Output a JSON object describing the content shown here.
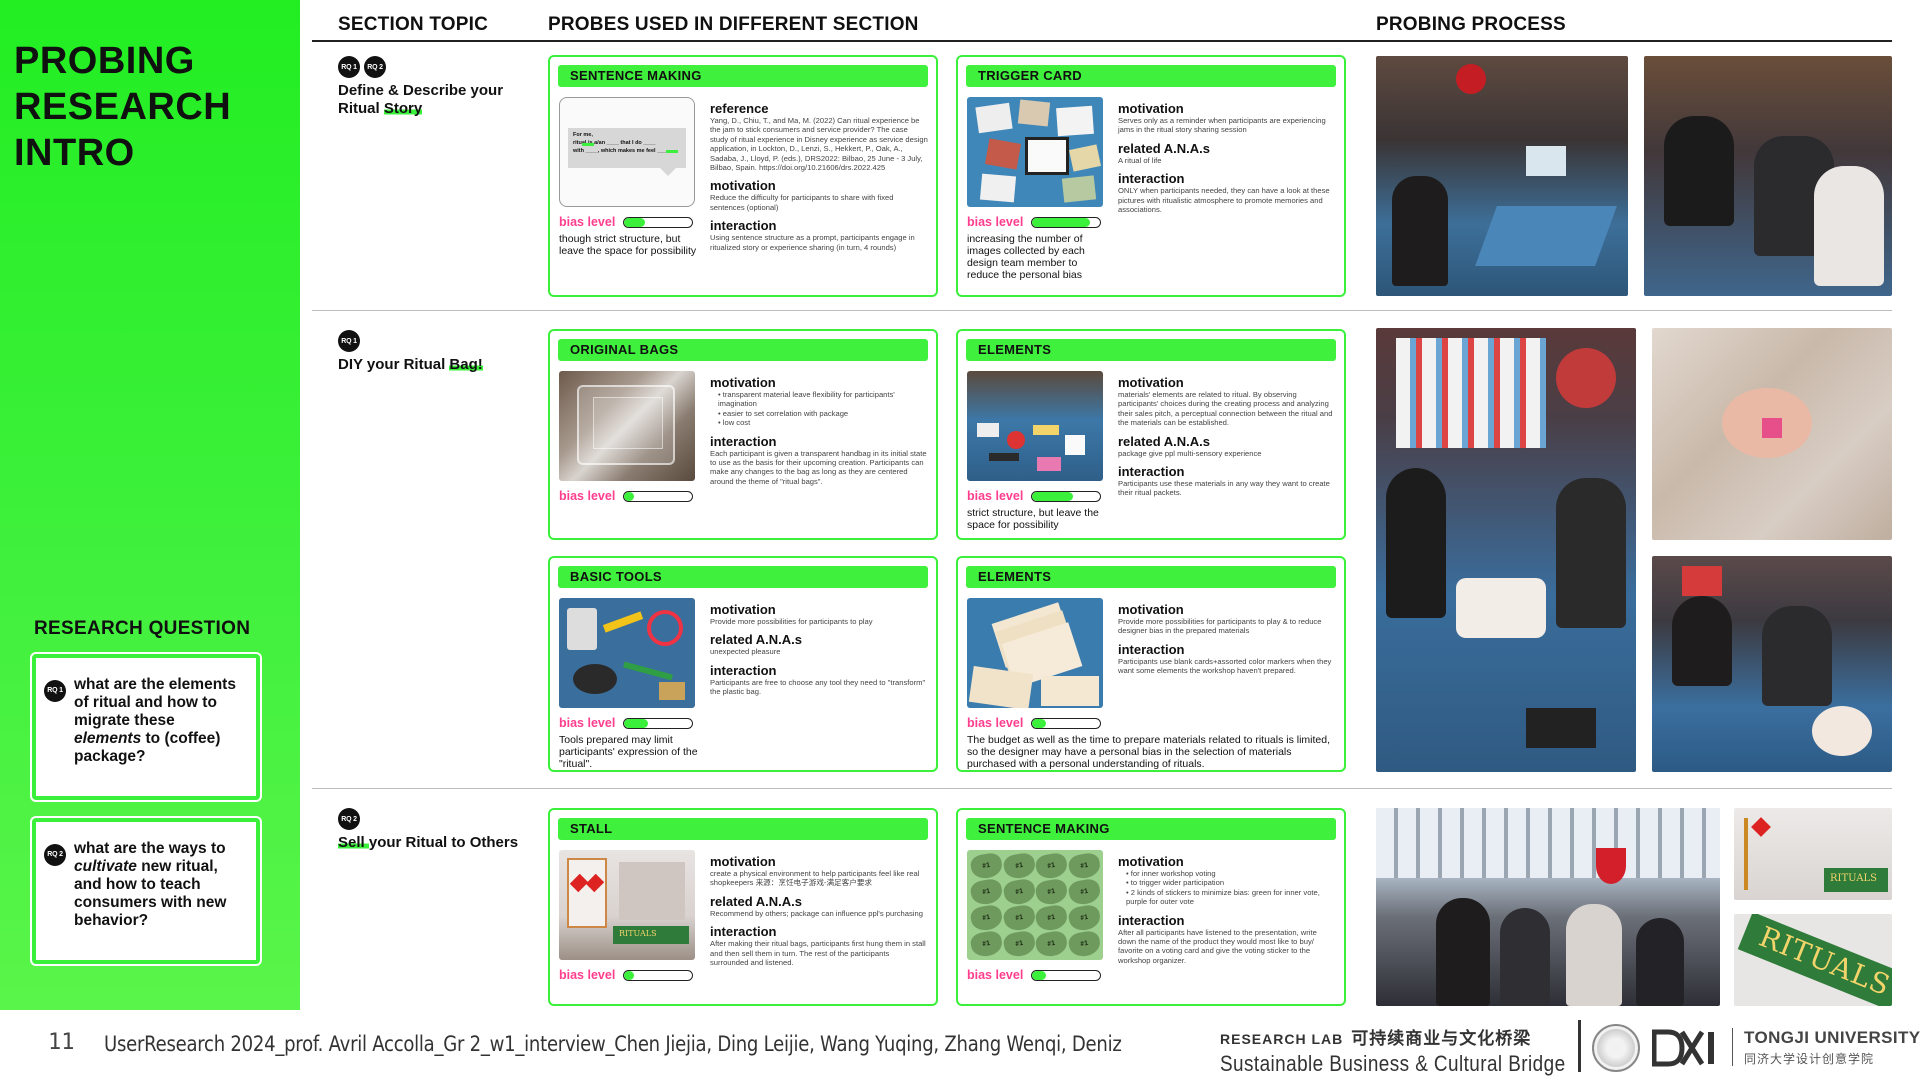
{
  "title": {
    "line1": "PROBING",
    "line2": "RESEARCH",
    "line3": "INTRO"
  },
  "research_question": {
    "heading": "RESEARCH QUESTION",
    "rq1": {
      "badge": "RQ 1",
      "pre": "what are the elements of ritual and how to migrate these ",
      "em": "elements",
      "post": " to (coffee) package?"
    },
    "rq2": {
      "badge": "RQ 2",
      "pre": "what are the ways to ",
      "em": "cultivate",
      "post": " new ritual, and how to teach consumers with new behavior?"
    }
  },
  "headers": {
    "section_topic": "SECTION TOPIC",
    "probes": "PROBES USED IN DIFFERENT SECTION",
    "process": "PROBING PROCESS"
  },
  "topics": [
    {
      "badges": [
        "RQ 1",
        "RQ 2"
      ],
      "pre": "Define & Describe your Ritual ",
      "hl": "Story",
      "post": ""
    },
    {
      "badges": [
        "RQ 1"
      ],
      "pre": "DIY your Ritual  ",
      "hl": "Bag!",
      "post": ""
    },
    {
      "badges": [
        "RQ 2"
      ],
      "pre": "",
      "hl": "Sell ",
      "post": "your Ritual to Others"
    }
  ],
  "bias_label": "bias level",
  "cards": {
    "sentence_making_1": {
      "title": "SENTENCE MAKING",
      "bias": 0.3,
      "note": "though strict structure, but leave the space for possibility",
      "sections": [
        {
          "h": "reference",
          "p": "Yang, D., Chiu, T., and Ma, M. (2022) Can ritual experience be the jam to stick consumers and service provider? The case study of ritual experience in Disney experience as service design application, in Lockton, D., Lenzi, S., Hekkert, P., Oak, A., Sadaba, J., Lloyd, P. (eds.), DRS2022: Bilbao, 25 June - 3 July, Bilbao, Spain. https://doi.org/10.21606/drs.2022.425"
        },
        {
          "h": "motivation",
          "p": "Reduce the difficulty for participants to share with fixed sentences (optional)"
        },
        {
          "h": "interaction",
          "p": "Using sentence structure as a prompt, participants engage in ritualized story or experience sharing    (in turn, 4 rounds)"
        }
      ],
      "img_text": {
        "l1": "For me,",
        "l2a": "ritual is a/an",
        "l2b": "that I do",
        "l3a": "with",
        "l3b": "which makes me feel"
      }
    },
    "trigger_card": {
      "title": "TRIGGER CARD",
      "bias": 0.85,
      "note": "increasing the number of images collected by each design team member to reduce the personal bias",
      "sections": [
        {
          "h": "motivation",
          "p": "Serves only as a reminder when participants are experiencing jams in the ritual story sharing session"
        },
        {
          "h": "related A.N.A.s",
          "p": "A ritual of life"
        },
        {
          "h": "interaction",
          "p": "ONLY when participants needed, they can have a look at these pictures with ritualistic atmosphere to promote memories and associations."
        }
      ]
    },
    "original_bags": {
      "title": "ORIGINAL BAGS",
      "bias": 0.15,
      "note": "",
      "motivation_h": "motivation",
      "motivation_list": [
        "transparent material leave flexibility for participants' imagination",
        "easier to set correlation with package",
        "low cost"
      ],
      "interaction_h": "interaction",
      "interaction_p": "Each participant is given a transparent handbag in its initial state to use as the basis for their upcoming creation. Participants can make any changes to the bag as long as they are centered around the theme of \"ritual bags\"."
    },
    "elements_1": {
      "title": "ELEMENTS",
      "bias": 0.6,
      "note": "strict structure, but leave the space for possibility",
      "sections": [
        {
          "h": "motivation",
          "p": "materials' elements are related to ritual. By observing participants' choices during the creating process and analyzing their sales pitch, a perceptual connection between the ritual and the materials can be established."
        },
        {
          "h": "related A.N.A.s",
          "p": "package give ppl multi-sensory experience"
        },
        {
          "h": "interaction",
          "p": "Participants use these materials in any way they want to create their ritual packets."
        }
      ]
    },
    "basic_tools": {
      "title": "BASIC TOOLS",
      "bias": 0.35,
      "note": "Tools prepared may limit participants' expression of the \"ritual\".",
      "sections": [
        {
          "h": "motivation",
          "p": "Provide more possibilities for participants to play"
        },
        {
          "h": "related A.N.A.s",
          "p": "unexpected pleasure"
        },
        {
          "h": "interaction",
          "p": "Participants are free to choose any tool they need to \"transform\" the plastic bag."
        }
      ]
    },
    "elements_2": {
      "title": "ELEMENTS",
      "bias": 0.2,
      "note": "The budget as well as the time to prepare materials related to rituals is limited, so the designer may have a personal bias in the selection of materials purchased with a personal understanding of rituals.",
      "sections": [
        {
          "h": "motivation",
          "p": "Provide more possibilities for participants to play & to reduce designer bias in the prepared materials"
        },
        {
          "h": "interaction",
          "p": "Participants use blank cards+assorted color markers when they want some elements the workshop haven't prepared."
        }
      ]
    },
    "stall": {
      "title": "STALL",
      "bias": 0.15,
      "note": "",
      "sections": [
        {
          "h": "motivation",
          "p": "create a physical environment to help participants feel like real shopkeepers 来源：烹饪电子游戏-满足客户要求"
        },
        {
          "h": "related A.N.A.s",
          "p": "Recommend by others; package can influence ppl's purchasing"
        },
        {
          "h": "interaction",
          "p": "After making their ritual bags, participants first hung them in stall and then sell them in turn. The rest of the participants surrounded and listened."
        }
      ],
      "sign": "RITUALS"
    },
    "sentence_making_2": {
      "title": "SENTENCE MAKING",
      "bias": 0.2,
      "note": "",
      "motivation_h": "motivation",
      "motivation_list": [
        "for inner workshop voting",
        "to trigger wider participation",
        "2 kinds of stickers to minimize bias: green for inner vote, purple for outer vote"
      ],
      "interaction_h": "interaction",
      "interaction_p": "After all participants have listened to the presentation, write down the name of the product they would most like to buy/ favorite on a voting card and give the voting sticker to the workshop organizer.",
      "heart_label": "#1"
    }
  },
  "photos": {
    "sign_text": "RITUALS",
    "sign_text_small": "RITUALS"
  },
  "footer": {
    "page": "11",
    "credit": "UserResearch 2024_prof. Avril Accolla_Gr 2_w1_interview_Chen Jiejia, Ding Leijie, Wang Yuqing, Zhang Wenqi, Deniz",
    "lab_en": "RESEARCH LAB",
    "lab_cn": "可持续商业与文化桥梁",
    "lab_sub": "Sustainable Business & Cultural Bridge",
    "dxi": "DXI",
    "university": "TONGJI UNIVERSITY",
    "university_cn": "同济大学设计创意学院"
  },
  "colors": {
    "accent_green": "#3bf03b",
    "bias_pink": "#ff3e8e"
  }
}
